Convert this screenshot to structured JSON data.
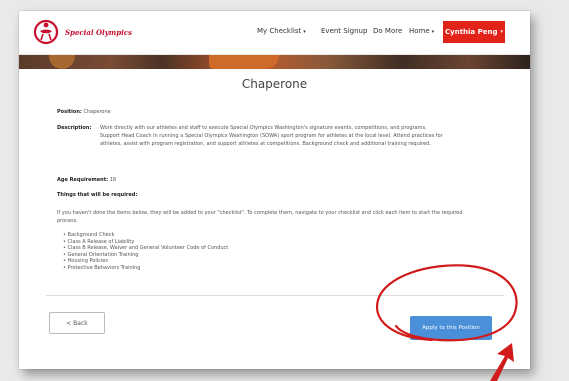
{
  "nav": {
    "logo_text": "Special Olympics",
    "links": [
      {
        "label": "My Checklist",
        "has_caret": true,
        "caret": "▾"
      },
      {
        "label": "Event Signup",
        "has_caret": false,
        "caret": ""
      },
      {
        "label": "Do More",
        "has_caret": false,
        "caret": ""
      },
      {
        "label": "Home",
        "has_caret": true,
        "caret": "▾"
      }
    ],
    "user_label": "Cynthia Peng",
    "user_caret": "▾"
  },
  "page": {
    "title": "Chaperone",
    "position_label": "Position:",
    "position_value": "Chaperone",
    "description_label": "Description:",
    "description_value": "Work directly with our athletes and staff to execute Special Olympics Washington's signature events, competitions, and programs. Support Head Coach in running a Special Olympics Washington (SOWA) sport program for athletes at the local level. Attend practices for athletes, assist with program registration, and support athletes at competitions. Background check and additional training required.",
    "age_label": "Age Requirement:",
    "age_value": "18",
    "required_heading": "Things that will be required:",
    "instructions": "If you haven't done the items below, they will be added to your \"checklist\". To complete them, navigate to your checklist and click each item to start the required process.",
    "requirements": [
      "Background Check",
      "Class A Release of Liability",
      "Class B Release, Waiver and General Volunteer Code of Conduct",
      "General Orientation Training",
      "Housing Policies",
      "Protective Behaviors Training"
    ]
  },
  "actions": {
    "back_label": "< Back",
    "apply_label": "Apply to this Position"
  },
  "colors": {
    "brand_red": "#e2231a",
    "apply_blue": "#4a90d9",
    "annotation_red": "#d11a1a"
  }
}
